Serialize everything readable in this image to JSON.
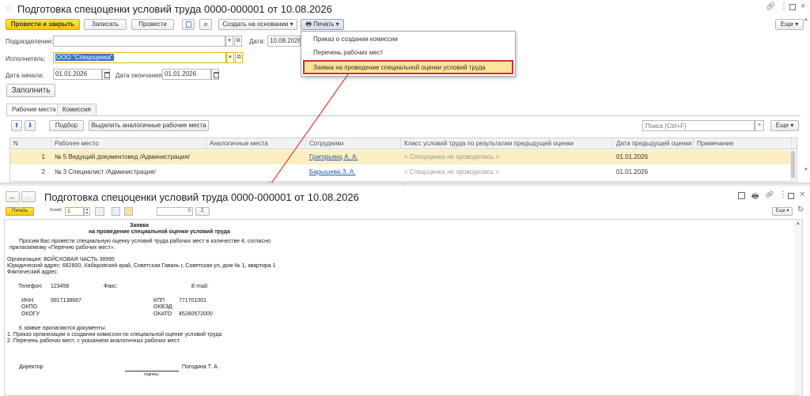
{
  "top_window": {
    "title": "Подготовка спецоценки условий труда 0000-000001 от 10.08.2026",
    "toolbar": {
      "post_close": "Провести и закрыть",
      "save": "Записать",
      "post": "Провести",
      "create_based": "Создать на основании",
      "print": "Печать",
      "more": "Еще"
    },
    "print_menu": {
      "items": [
        "Приказ о создании комиссии",
        "Перечень рабочих мест",
        "Заявка на проведение специальной оценки условий труда"
      ]
    },
    "form": {
      "division_label": "Подразделение:",
      "division_value": "",
      "date_label": "Дата:",
      "date_value": "10.08.2026",
      "executor_label": "Исполнитель:",
      "executor_value": "ООО \"Спецоценка\"",
      "start_label": "Дата начала:",
      "start_value": "01.01.2026",
      "end_label": "Дата окончания:",
      "end_value": "01.01.2026",
      "fill_button": "Заполнить"
    },
    "tabs": [
      "Рабочие места",
      "Комиссия"
    ],
    "table_toolbar": {
      "select": "Подбор",
      "highlight": "Выделить аналогичные рабочие места",
      "search_placeholder": "Поиск (Ctrl+F)",
      "more": "Еще"
    },
    "table": {
      "headers": [
        "N",
        "Рабочее место",
        "Аналогичные места",
        "Сотрудники",
        "Класс условий труда по результатам предыдущей оценки",
        "Дата предыдущей оценки",
        "Примечание"
      ],
      "rows": [
        [
          "1",
          "№ 5 Ведущий документовед /Администрация/",
          "",
          "Григорьянц А. А.",
          "< Спецоценка не проводилась >",
          "01.01.2026",
          ""
        ],
        [
          "2",
          "№ 3 Специалист /Администрация/",
          "",
          "Барышева З. А.",
          "< Спецоценка не проводилась >",
          "01.01.2026",
          ""
        ]
      ]
    }
  },
  "bottom_window": {
    "title": "Подготовка спецоценки условий труда 0000-000001 от 10.08.2026",
    "toolbar": {
      "print": "Печать",
      "copies_label": "Копий:",
      "copies_value": "1",
      "sum_value": "0",
      "sum_symbol": "Σ",
      "more": "Еще"
    },
    "document": {
      "heading1": "Заявка",
      "heading2": "на проведение специальной оценки условий труда",
      "para1": "Просим  Вас  провести  специальную  оценку  условий  труда  рабочих  мест  в  количестве  4,  согласно",
      "para2": "прилагаемому «Перечню рабочих мест».",
      "org": "Организация: ВОЙСКОВАЯ ЧАСТЬ 38995",
      "legal_address": "Юридический адрес: 682800, Хабаровский край, Советская Гавань г, Советская ул, дом № 1, квартира 1",
      "actual_address": "Фактический адрес:",
      "phone_label": "Телефон:",
      "phone_value": "123456",
      "fax_label": "Факс:",
      "email_label": "E-mail:",
      "inn_label": "ИНН",
      "inn_value": "9917138687",
      "kpp_label": "КПП",
      "kpp_value": "771701001",
      "okpo_label": "ОКПО",
      "okved_label": "ОКВЭД",
      "okogu_label": "ОКОГУ",
      "okato_label": "ОКАТО",
      "okato_value": "45280572000",
      "attach_intro": "К заявке прилагаются документы:",
      "attach1": "1.    Приказ организации о создании  комиссии по специальной оценке условий труда",
      "attach2": "2.    Перечень рабочих мест, с указанием аналогичных рабочих мест",
      "director_label": "Директор",
      "director_name": "Погодина Т. А.",
      "signature_label": "подпись"
    }
  },
  "colors": {
    "accent_yellow": "#f6c700",
    "highlight_row": "#fbeec0",
    "menu_highlight_border": "#d32f2f",
    "arrow": "#e53935",
    "link": "#1a5aa8"
  }
}
